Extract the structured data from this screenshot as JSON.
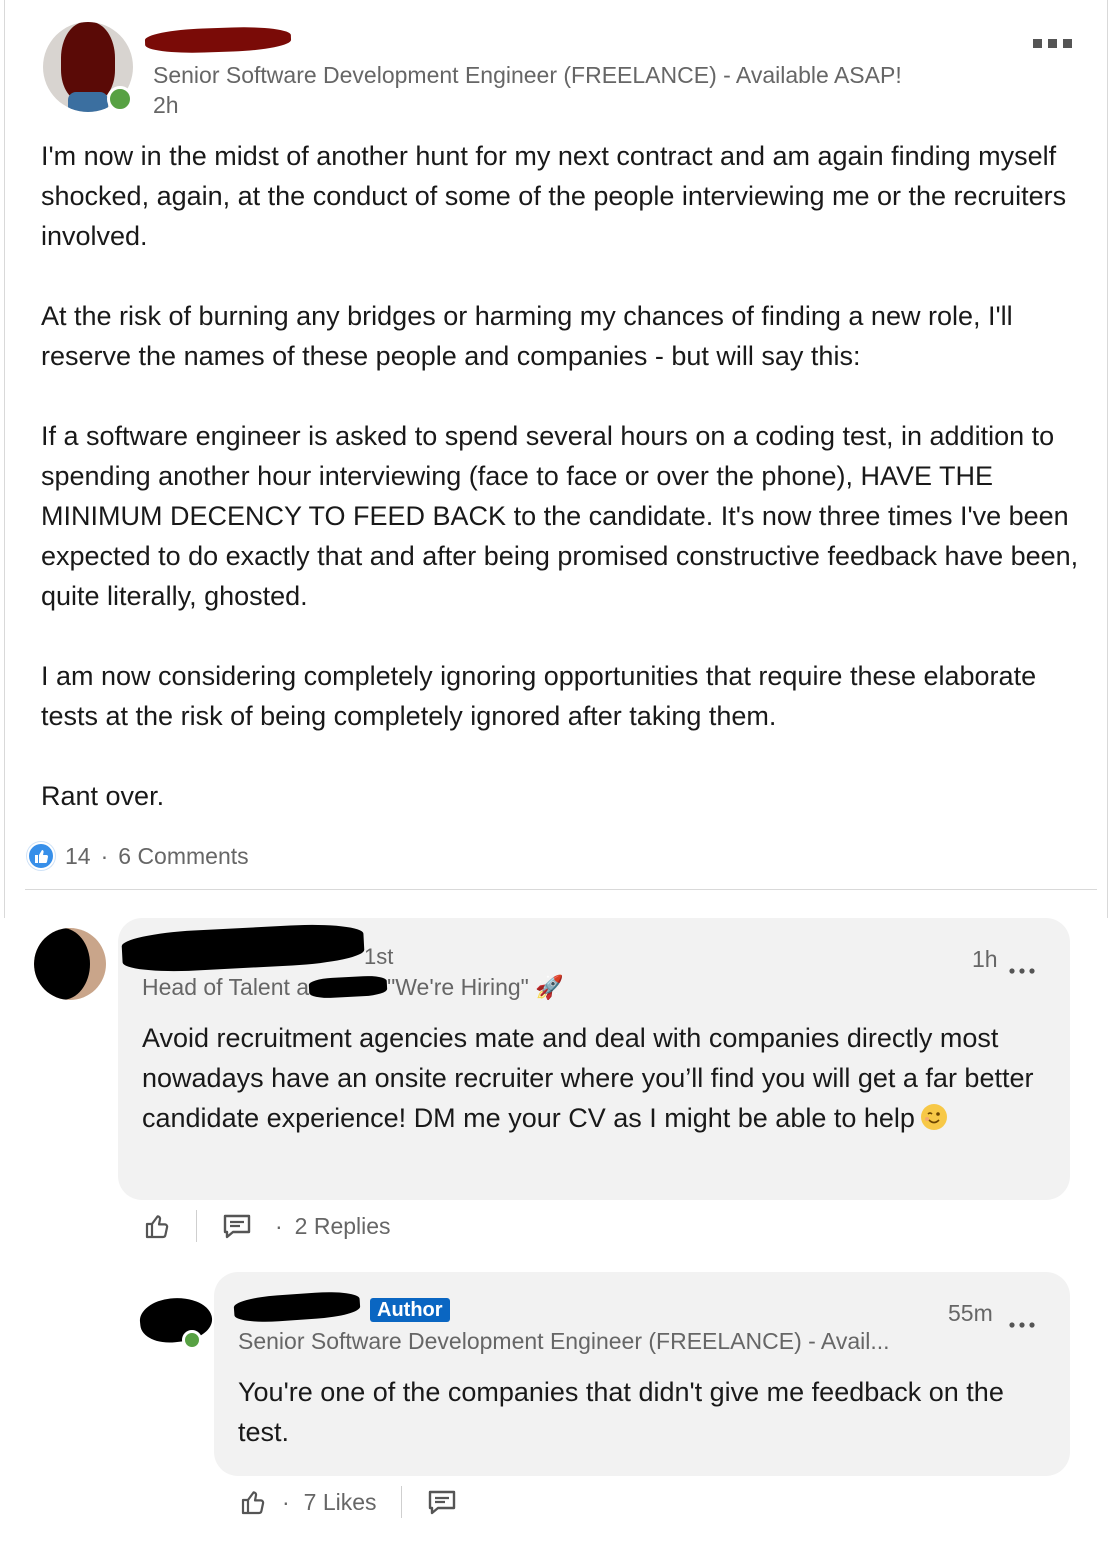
{
  "post": {
    "headline": "Senior Software Development Engineer (FREELANCE) - Available ASAP!",
    "time": "2h",
    "paragraphs": [
      "I'm now in the midst of another hunt for my next contract and am again finding myself shocked, again, at the conduct of some of the people interviewing me or the recruiters involved.",
      "At the risk of burning any bridges or harming my chances of finding a new role, I'll reserve the names of these people and companies - but will say this:",
      "If a software engineer is asked to spend several hours on a coding test, in addition to spending another hour interviewing (face to face or over the phone), HAVE THE MINIMUM DECENCY TO FEED BACK to the candidate. It's now three times I've been expected to do exactly that and after being promised constructive feedback have been, quite literally, ghosted.",
      "I am now considering completely ignoring opportunities that require these elaborate tests at the risk of being completely ignored after taking them.",
      "Rant over."
    ],
    "reactions_count": "14",
    "comments_count": "6 Comments"
  },
  "comment1": {
    "degree": "1st",
    "headline_prefix": "Head of Talent a",
    "headline_suffix": "\"We're Hiring\" 🚀",
    "time": "1h",
    "text": "Avoid recruitment agencies mate and deal with companies directly most nowadays have an onsite recruiter where you’ll find you will get a far better candidate experience! DM me your CV as I might be able to help",
    "emoji": "wink-emoji",
    "replies": "2 Replies"
  },
  "reply1": {
    "badge": "Author",
    "headline": "Senior Software Development Engineer (FREELANCE) - Avail...",
    "time": "55m",
    "text": "You're one of the companies that didn't give me feedback on the test.",
    "likes": "7 Likes"
  },
  "icons": [
    "more-icon",
    "like-icon",
    "reply-icon",
    "online-status-icon"
  ],
  "colors": {
    "accent": "#0a66c2",
    "online": "#57a143",
    "bubble": "#f2f2f2",
    "like_badge": "#378fe9"
  }
}
